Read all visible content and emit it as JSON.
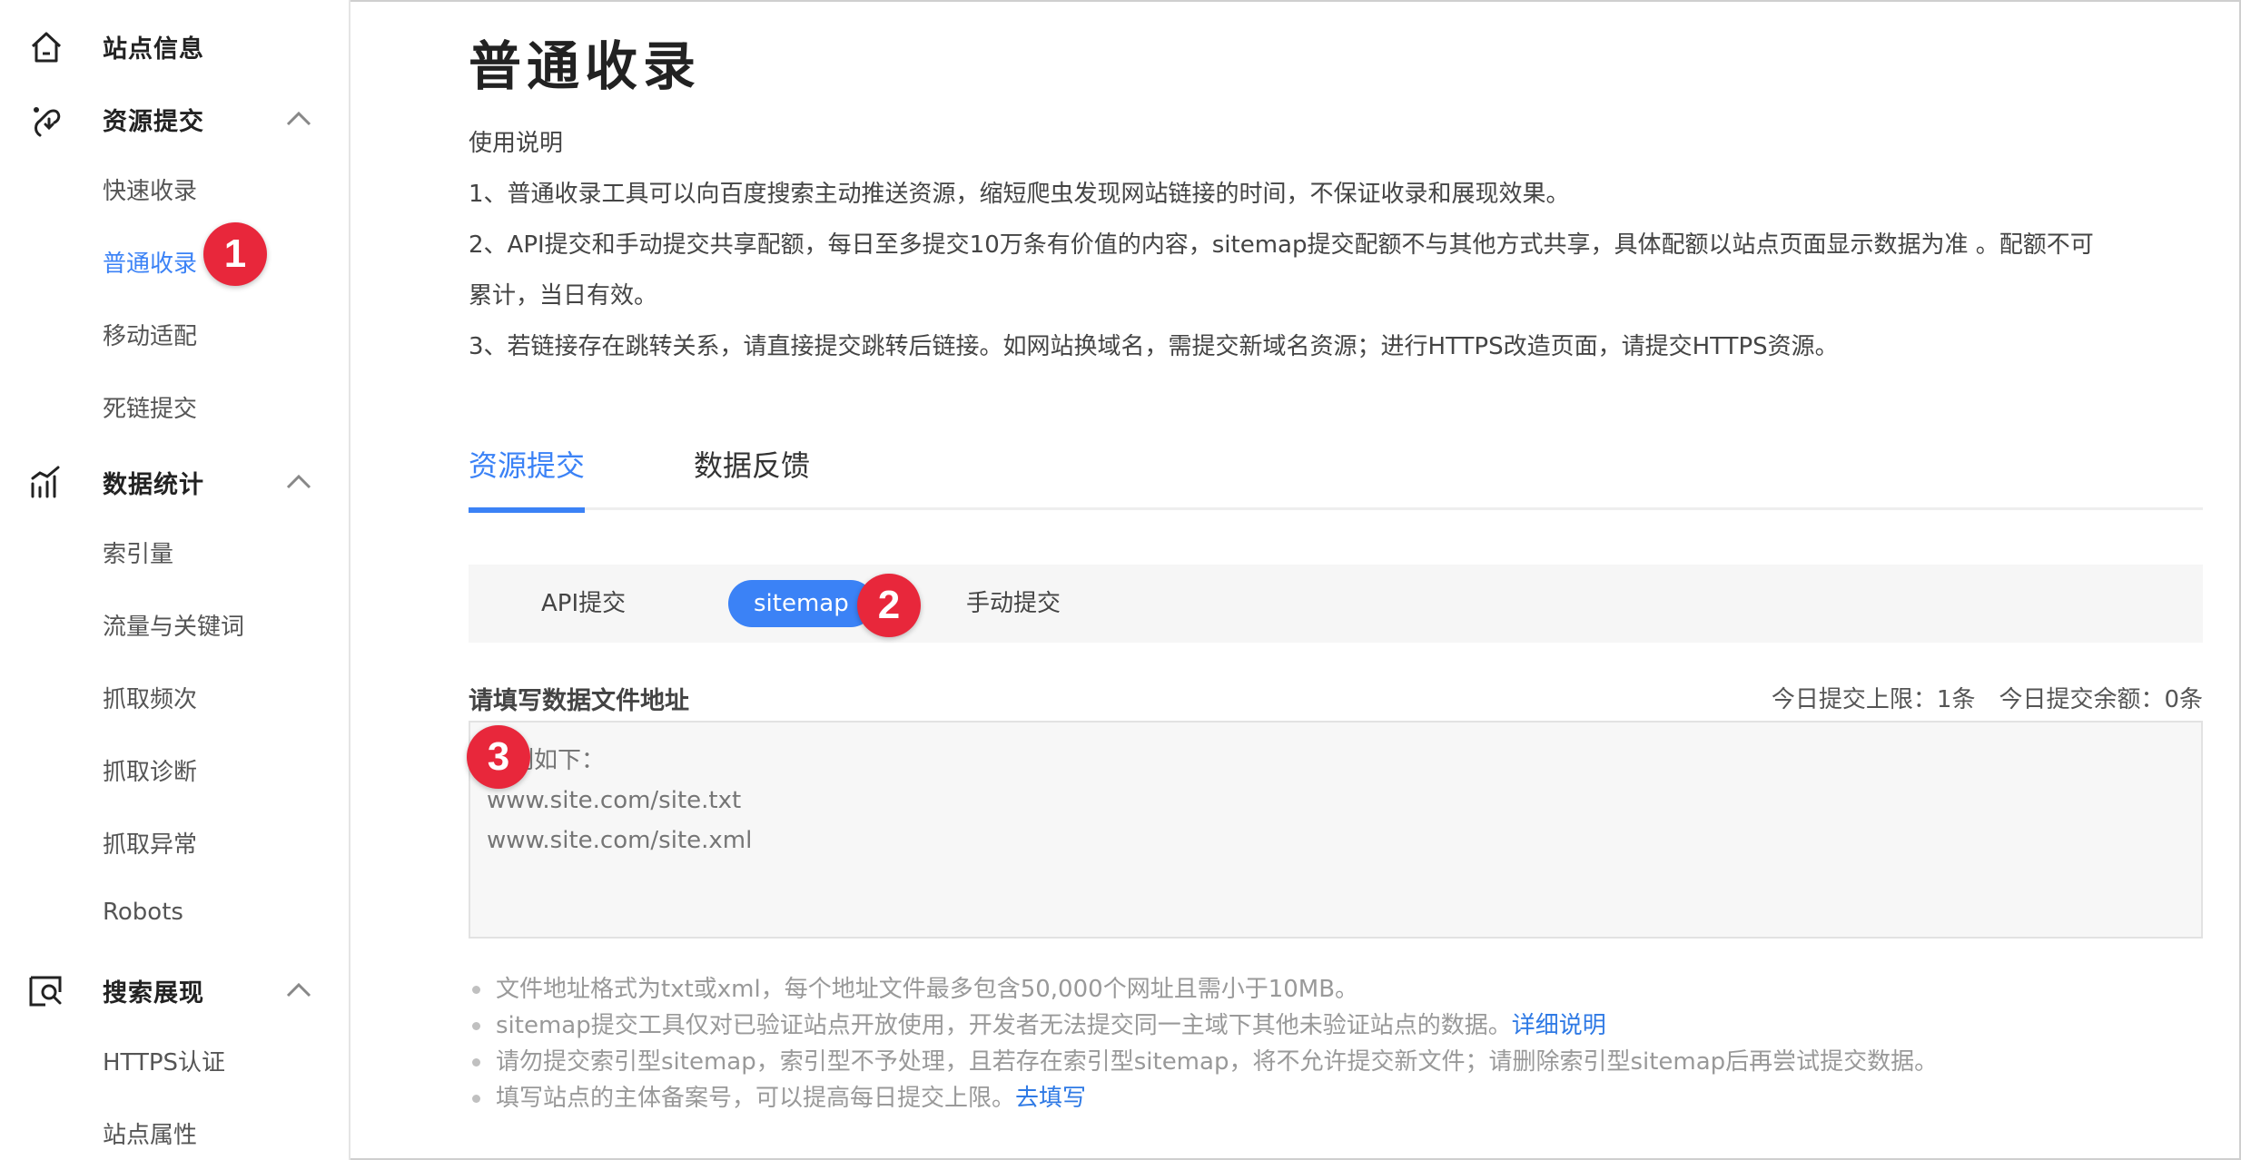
{
  "sidebar": {
    "groups": [
      {
        "label": "站点信息",
        "icon": "home-icon",
        "expandable": false
      },
      {
        "label": "资源提交",
        "icon": "submit-resource-icon",
        "expandable": true,
        "items": [
          {
            "label": "快速收录"
          },
          {
            "label": "普通收录",
            "active": true
          },
          {
            "label": "移动适配"
          },
          {
            "label": "死链提交"
          }
        ]
      },
      {
        "label": "数据统计",
        "icon": "stats-icon",
        "expandable": true,
        "items": [
          {
            "label": "索引量"
          },
          {
            "label": "流量与关键词"
          },
          {
            "label": "抓取频次"
          },
          {
            "label": "抓取诊断"
          },
          {
            "label": "抓取异常"
          },
          {
            "label": "Robots"
          }
        ]
      },
      {
        "label": "搜索展现",
        "icon": "search-display-icon",
        "expandable": true,
        "items": [
          {
            "label": "HTTPS认证"
          },
          {
            "label": "站点属性"
          }
        ]
      }
    ]
  },
  "main": {
    "title": "普通收录",
    "usage": {
      "heading": "使用说明",
      "line1": "1、普通收录工具可以向百度搜索主动推送资源，缩短爬虫发现网站链接的时间，不保证收录和展现效果。",
      "line2a": "2、API提交和手动提交共享配额，每日至多提交10万条有价值的内容，sitemap提交配额不与其他方式共享，具体配额以站点页面显示数据为准 。配额不可",
      "line2b": "累计，当日有效。",
      "line3": "3、若链接存在跳转关系，请直接提交跳转后链接。如网站换域名，需提交新域名资源；进行HTTPS改造页面，请提交HTTPS资源。"
    },
    "tabs": [
      {
        "label": "资源提交",
        "active": true
      },
      {
        "label": "数据反馈",
        "active": false
      }
    ],
    "subtabs": [
      {
        "label": "API提交"
      },
      {
        "label": "sitemap",
        "active": true
      },
      {
        "label": "手动提交"
      }
    ],
    "form": {
      "label": "请填写数据文件地址",
      "quota_limit": "今日提交上限：1条",
      "quota_remaining": "今日提交余额：0条",
      "placeholder": "示例如下：\nwww.site.com/site.txt\nwww.site.com/site.xml"
    },
    "notes": {
      "n1": "文件地址格式为txt或xml，每个地址文件最多包含50,000个网址且需小于10MB。",
      "n2": "sitemap提交工具仅对已验证站点开放使用，开发者无法提交同一主域下其他未验证站点的数据。",
      "n2_link": "详细说明",
      "n3": "请勿提交索引型sitemap，索引型不予处理，且若存在索引型sitemap，将不允许提交新文件；请删除索引型sitemap后再尝试提交数据。",
      "n4": "填写站点的主体备案号，可以提高每日提交上限。",
      "n4_link": "去填写"
    }
  },
  "markers": {
    "m1": "1",
    "m2": "2",
    "m3": "3"
  },
  "colors": {
    "accent": "#3b82f6",
    "marker": "#e8273b",
    "link": "#2f7ae5"
  }
}
